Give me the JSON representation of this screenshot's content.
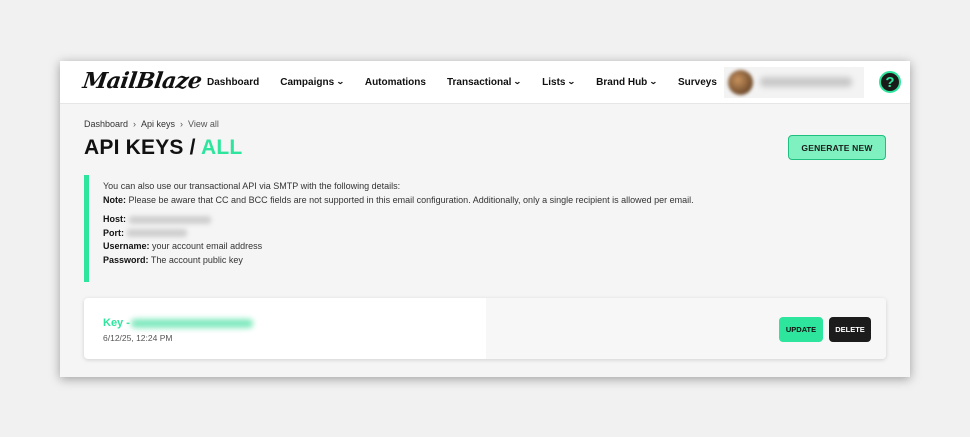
{
  "header": {
    "logo": "MailBlaze",
    "nav": [
      {
        "label": "Dashboard",
        "dropdown": false
      },
      {
        "label": "Campaigns",
        "dropdown": true
      },
      {
        "label": "Automations",
        "dropdown": false
      },
      {
        "label": "Transactional",
        "dropdown": true
      },
      {
        "label": "Lists",
        "dropdown": true
      },
      {
        "label": "Brand Hub",
        "dropdown": true
      },
      {
        "label": "Surveys",
        "dropdown": false
      }
    ],
    "help_glyph": "?",
    "chevron_glyph": "⌄"
  },
  "breadcrumb": {
    "items": [
      "Dashboard",
      "Api keys",
      "View all"
    ],
    "separator": "›"
  },
  "page": {
    "title_main": "API KEYS / ",
    "title_accent": "ALL",
    "generate_label": "GENERATE NEW"
  },
  "info": {
    "intro": "You can also use our transactional API via SMTP with the following details:",
    "note_label": "Note:",
    "note_text": " Please be aware that CC and BCC fields are not supported in this email configuration. Additionally, only a single recipient is allowed per email.",
    "host_label": "Host:",
    "port_label": "Port:",
    "username_label": "Username:",
    "username_value": " your account email address",
    "password_label": "Password:",
    "password_value": " The account public key"
  },
  "key_card": {
    "key_label": "Key -",
    "date": "6/12/25, 12:24 PM",
    "update_label": "UPDATE",
    "delete_label": "DELETE"
  },
  "colors": {
    "accent": "#2ee59d",
    "dark": "#1c1c1c"
  }
}
